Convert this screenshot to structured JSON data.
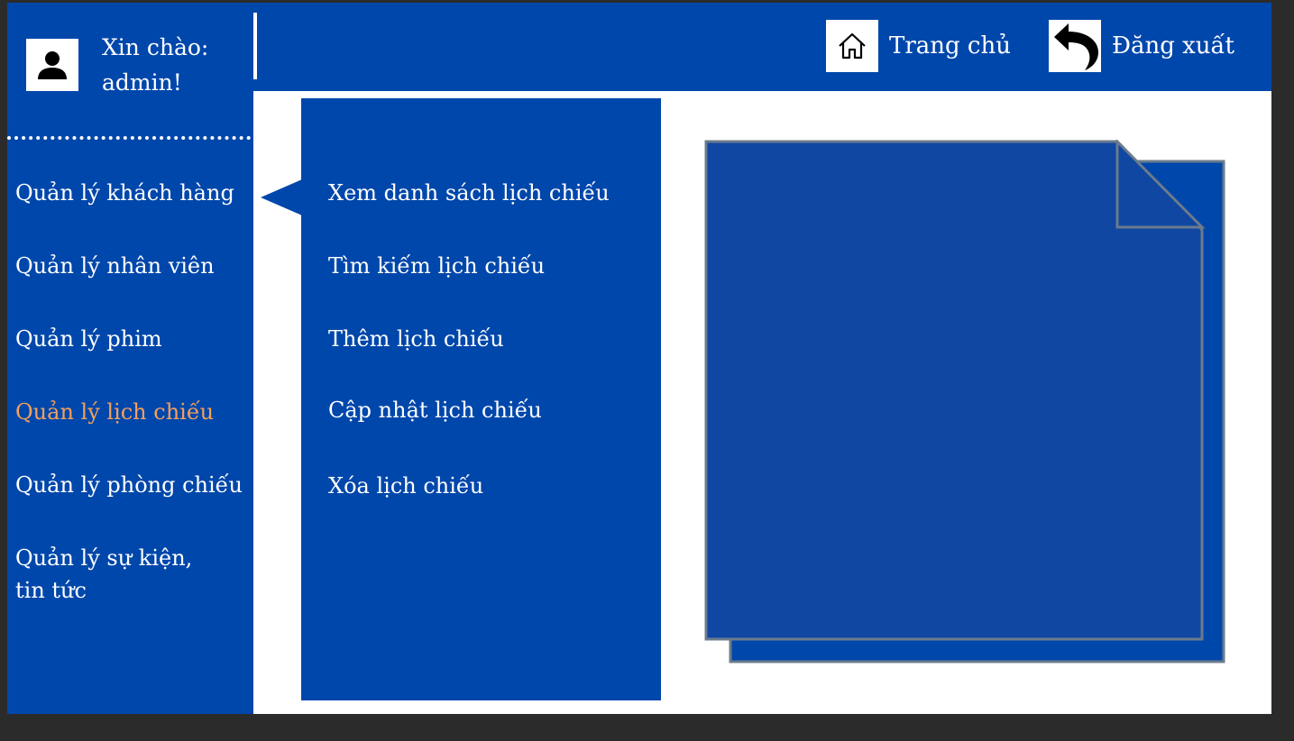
{
  "user": {
    "greeting_line1": "Xin chào:",
    "greeting_line2": "admin!",
    "avatar_icon": "user-icon"
  },
  "header": {
    "home": {
      "label": "Trang chủ",
      "icon": "home-icon"
    },
    "logout": {
      "label": "Đăng xuất",
      "icon": "undo-arrow-icon"
    }
  },
  "sidebar": {
    "items": [
      {
        "label": "Quản lý khách hàng"
      },
      {
        "label": "Quản lý nhân viên"
      },
      {
        "label": "Quản lý phim"
      },
      {
        "label": "Quản lý lịch chiếu",
        "active": true
      },
      {
        "label": "Quản lý phòng chiếu"
      },
      {
        "label_line1": "Quản lý sự kiện,",
        "label_line2": "tin tức"
      }
    ]
  },
  "submenu": {
    "items": [
      {
        "label": "Xem danh sách lịch chiếu"
      },
      {
        "label": "Tìm kiếm lịch chiếu"
      },
      {
        "label": "Thêm lịch chiếu"
      },
      {
        "label": "Cập nhật lịch chiếu"
      },
      {
        "label": "Xóa lịch chiếu"
      }
    ]
  },
  "colors": {
    "primary": "#0047AB",
    "active": "#F5A05A",
    "doc_fill": "#0F47A3",
    "doc_border": "#6B7B8C"
  }
}
